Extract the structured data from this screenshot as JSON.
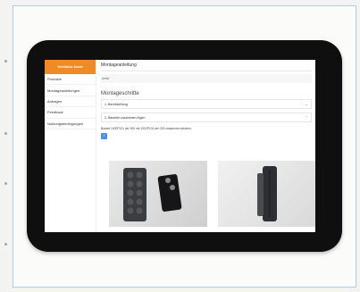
{
  "app": {
    "logo": "Ventilation Assist",
    "title": "Montageanleitung"
  },
  "sidebar": {
    "items": [
      {
        "label": "Produkte"
      },
      {
        "label": "Montageanleitungen"
      },
      {
        "label": "Anfragen"
      },
      {
        "label": "Feedback"
      },
      {
        "label": "Nutzungsbedingungen"
      }
    ]
  },
  "main": {
    "crumb": "weiter",
    "section_title": "Montageschritte",
    "accordions": [
      {
        "label": "1. Bereitstellung"
      },
      {
        "label": "2. Bauteile zusammen fügen"
      }
    ],
    "step_text": "Bauteil 1000P131 der 300 mit 1002P131 der 303 zusammen stecken.",
    "nav_button_icon": "next-icon"
  },
  "photos": [
    {
      "name": "assembly-photo-front"
    },
    {
      "name": "assembly-photo-side"
    }
  ],
  "colors": {
    "accent": "#f08a24",
    "button": "#4a90e2",
    "frame": "#0f0f10"
  }
}
